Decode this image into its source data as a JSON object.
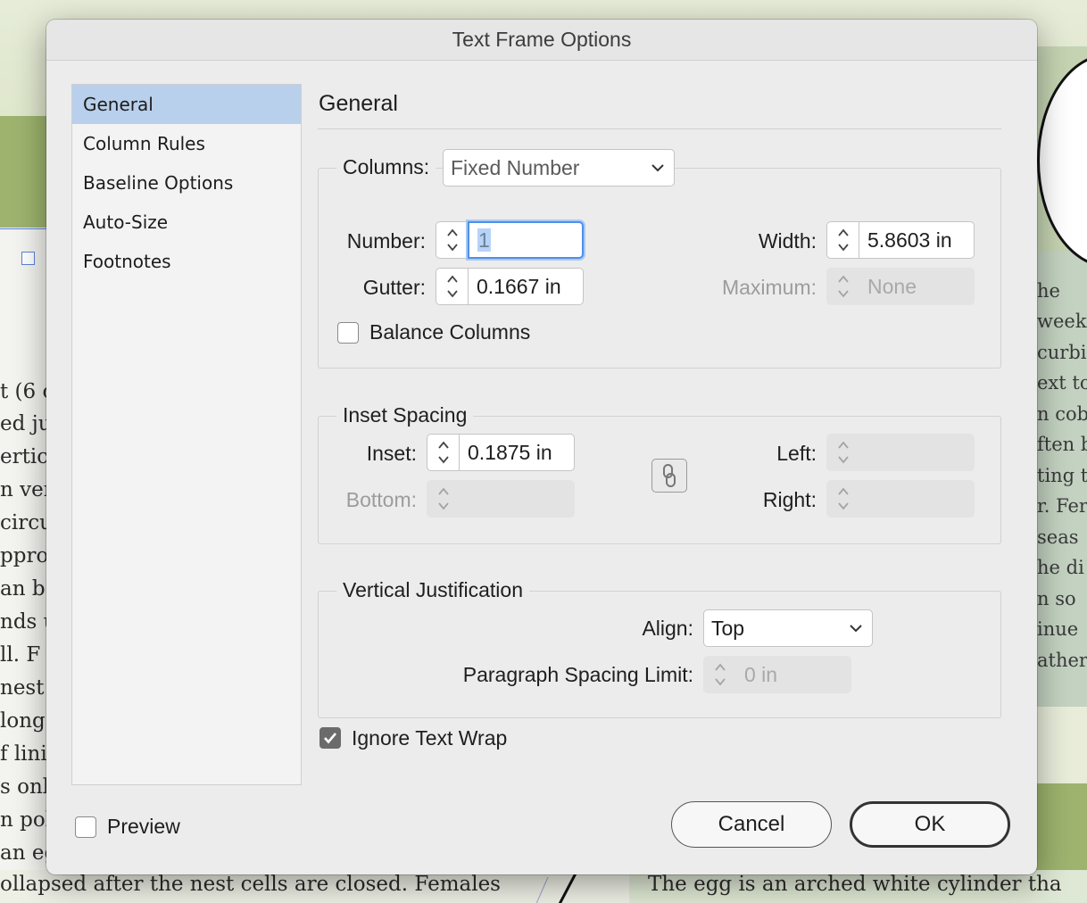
{
  "background": {
    "left_text_lines": [
      "t (6 c",
      "ed ju",
      "ertic",
      "n ver",
      "circu",
      "ppro",
      "an b",
      "nds u",
      "ll. F",
      "nest",
      "long",
      "f linin",
      "s onl",
      "n pol",
      "an eg"
    ],
    "right_text_lines": [
      "he",
      "week",
      "curbi",
      "ext to",
      "n cob",
      "ften b",
      "ting t",
      "r. Fer",
      "seas",
      "he di",
      "n so",
      "inue",
      "ather"
    ],
    "bottom_left_text": "ollapsed after the nest cells are closed. Females",
    "bottom_right_text": "The egg is an arched white cylinder tha"
  },
  "dialog": {
    "title": "Text Frame Options",
    "sidebar": [
      {
        "label": "General",
        "active": true
      },
      {
        "label": "Column Rules",
        "active": false
      },
      {
        "label": "Baseline Options",
        "active": false
      },
      {
        "label": "Auto-Size",
        "active": false
      },
      {
        "label": "Footnotes",
        "active": false
      }
    ],
    "section_title": "General",
    "columns": {
      "legend_label": "Columns:",
      "type_value": "Fixed Number",
      "number_label": "Number:",
      "number_value": "1",
      "gutter_label": "Gutter:",
      "gutter_value": "0.1667 in",
      "width_label": "Width:",
      "width_value": "5.8603 in",
      "maximum_label": "Maximum:",
      "maximum_value": "None",
      "balance_label": "Balance Columns",
      "balance_checked": false
    },
    "inset": {
      "legend": "Inset Spacing",
      "inset_label": "Inset:",
      "inset_value": "0.1875 in",
      "bottom_label": "Bottom:",
      "left_label": "Left:",
      "right_label": "Right:"
    },
    "vertical": {
      "legend": "Vertical Justification",
      "align_label": "Align:",
      "align_value": "Top",
      "psl_label": "Paragraph Spacing Limit:",
      "psl_value": "0 in"
    },
    "ignore_wrap": {
      "label": "Ignore Text Wrap",
      "checked": true
    },
    "preview": {
      "label": "Preview",
      "checked": false
    },
    "buttons": {
      "cancel": "Cancel",
      "ok": "OK"
    }
  },
  "colors": {
    "sidebar_active": "#b9d0ec",
    "focus_ring": "#4f8fe8",
    "dialog_bg": "#ececec"
  }
}
